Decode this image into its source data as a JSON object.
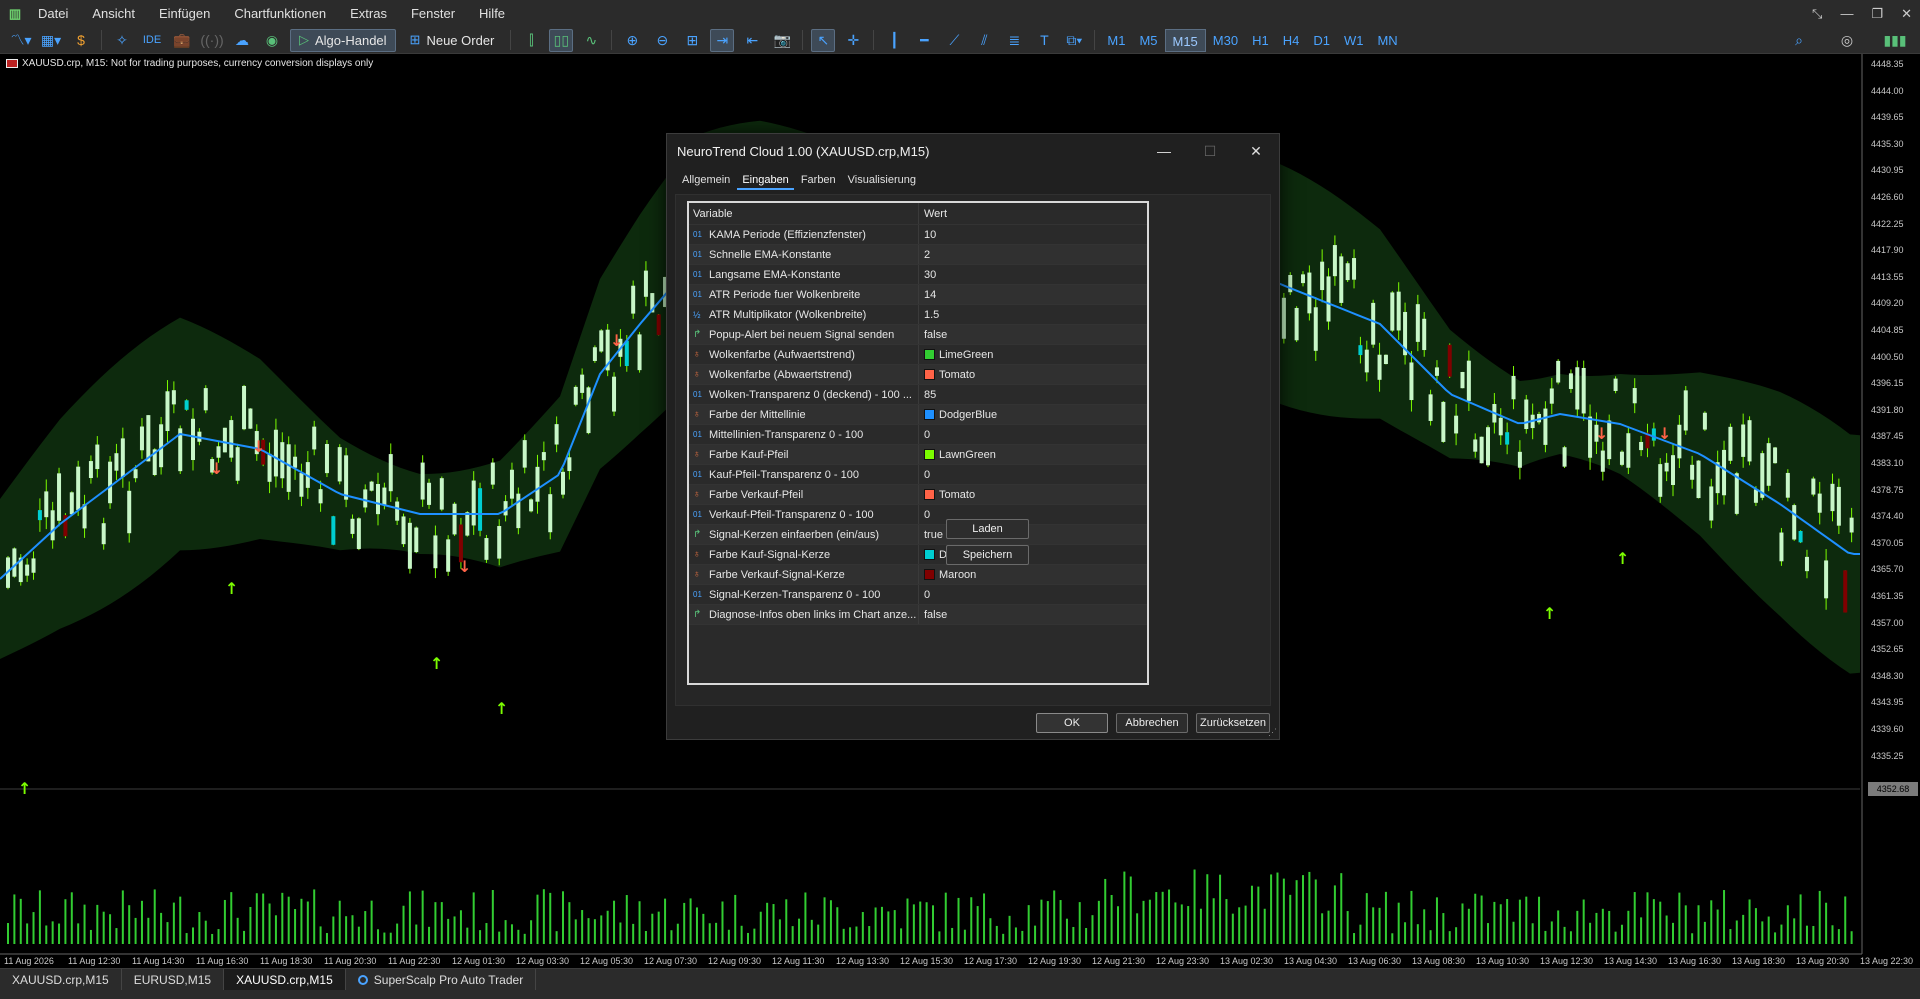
{
  "menubar": {
    "items": [
      "Datei",
      "Ansicht",
      "Einfügen",
      "Chartfunktionen",
      "Extras",
      "Fenster",
      "Hilfe"
    ]
  },
  "toolbar": {
    "algo_label": "Algo-Handel",
    "order_label": "Neue Order",
    "ide_label": "IDE",
    "timeframes": [
      "M1",
      "M5",
      "M15",
      "M30",
      "H1",
      "H4",
      "D1",
      "W1",
      "MN"
    ],
    "active_timeframe": "M15"
  },
  "chart": {
    "label": "XAUUSD.crp, M15:  Not for trading purposes, currency conversion displays only",
    "current_price": "4352.68",
    "price_levels": [
      "4448.35",
      "4444.00",
      "4439.65",
      "4435.30",
      "4430.95",
      "4426.60",
      "4422.25",
      "4417.90",
      "4413.55",
      "4409.20",
      "4404.85",
      "4400.50",
      "4396.15",
      "4391.80",
      "4387.45",
      "4383.10",
      "4378.75",
      "4374.40",
      "4370.05",
      "4365.70",
      "4361.35",
      "4357.00",
      "4352.65",
      "4348.30",
      "4343.95",
      "4339.60",
      "4335.25"
    ],
    "time_labels": [
      "11 Aug 2026",
      "11 Aug 12:30",
      "11 Aug 14:30",
      "11 Aug 16:30",
      "11 Aug 18:30",
      "11 Aug 20:30",
      "11 Aug 22:30",
      "12 Aug 01:30",
      "12 Aug 03:30",
      "12 Aug 05:30",
      "12 Aug 07:30",
      "12 Aug 09:30",
      "12 Aug 11:30",
      "12 Aug 13:30",
      "12 Aug 15:30",
      "12 Aug 17:30",
      "12 Aug 19:30",
      "12 Aug 21:30",
      "12 Aug 23:30",
      "13 Aug 02:30",
      "13 Aug 04:30",
      "13 Aug 06:30",
      "13 Aug 08:30",
      "13 Aug 10:30",
      "13 Aug 12:30",
      "13 Aug 14:30",
      "13 Aug 16:30",
      "13 Aug 18:30",
      "13 Aug 20:30",
      "13 Aug 22:30"
    ],
    "colors": {
      "cloud": "#0d2a0d",
      "midline": "#1e90ff",
      "bull": "#c8f7c8",
      "bull_signal": "#00ced1",
      "bear_signal": "#800000",
      "buy_arrow": "#7cfc00",
      "sell_arrow": "#ff6347",
      "volume": "#32cd32"
    }
  },
  "dialog": {
    "title": "NeuroTrend Cloud 1.00 (XAUUSD.crp,M15)",
    "tabs": [
      "Allgemein",
      "Eingaben",
      "Farben",
      "Visualisierung"
    ],
    "active_tab": "Eingaben",
    "columns": {
      "variable": "Variable",
      "value": "Wert"
    },
    "params": [
      {
        "icon": "int",
        "name": "KAMA Periode (Effizienzfenster)",
        "value": "10"
      },
      {
        "icon": "int",
        "name": "Schnelle EMA-Konstante",
        "value": "2"
      },
      {
        "icon": "int",
        "name": "Langsame EMA-Konstante",
        "value": "30"
      },
      {
        "icon": "int",
        "name": "ATR Periode fuer Wolkenbreite",
        "value": "14"
      },
      {
        "icon": "double",
        "name": "ATR Multiplikator (Wolkenbreite)",
        "value": "1.5"
      },
      {
        "icon": "bool",
        "name": "Popup-Alert bei neuem Signal senden",
        "value": "false"
      },
      {
        "icon": "color",
        "name": "Wolkenfarbe (Aufwaertstrend)",
        "value": "LimeGreen",
        "swatch": "#32cd32"
      },
      {
        "icon": "color",
        "name": "Wolkenfarbe (Abwaertstrend)",
        "value": "Tomato",
        "swatch": "#ff6347"
      },
      {
        "icon": "int",
        "name": "Wolken-Transparenz 0 (deckend) - 100 ...",
        "value": "85"
      },
      {
        "icon": "color",
        "name": "Farbe der Mittellinie",
        "value": "DodgerBlue",
        "swatch": "#1e90ff"
      },
      {
        "icon": "int",
        "name": "Mittellinien-Transparenz 0 - 100",
        "value": "0"
      },
      {
        "icon": "color",
        "name": "Farbe Kauf-Pfeil",
        "value": "LawnGreen",
        "swatch": "#7cfc00"
      },
      {
        "icon": "int",
        "name": "Kauf-Pfeil-Transparenz 0 - 100",
        "value": "0"
      },
      {
        "icon": "color",
        "name": "Farbe Verkauf-Pfeil",
        "value": "Tomato",
        "swatch": "#ff6347"
      },
      {
        "icon": "int",
        "name": "Verkauf-Pfeil-Transparenz 0 - 100",
        "value": "0"
      },
      {
        "icon": "bool",
        "name": "Signal-Kerzen einfaerben (ein/aus)",
        "value": "true"
      },
      {
        "icon": "color",
        "name": "Farbe Kauf-Signal-Kerze",
        "value": "DarkTurquoise",
        "swatch": "#00ced1"
      },
      {
        "icon": "color",
        "name": "Farbe Verkauf-Signal-Kerze",
        "value": "Maroon",
        "swatch": "#800000"
      },
      {
        "icon": "int",
        "name": "Signal-Kerzen-Transparenz 0 - 100",
        "value": "0"
      },
      {
        "icon": "bool",
        "name": "Diagnose-Infos oben links im Chart anze...",
        "value": "false"
      }
    ],
    "buttons": {
      "load": "Laden",
      "save": "Speichern",
      "ok": "OK",
      "cancel": "Abbrechen",
      "reset": "Zurücksetzen"
    }
  },
  "bottom_tabs": [
    {
      "label": "XAUUSD.crp,M15",
      "active": false
    },
    {
      "label": "EURUSD,M15",
      "active": false
    },
    {
      "label": "XAUUSD.crp,M15",
      "active": true
    },
    {
      "label": "SuperScalp Pro Auto Trader",
      "active": false
    }
  ]
}
